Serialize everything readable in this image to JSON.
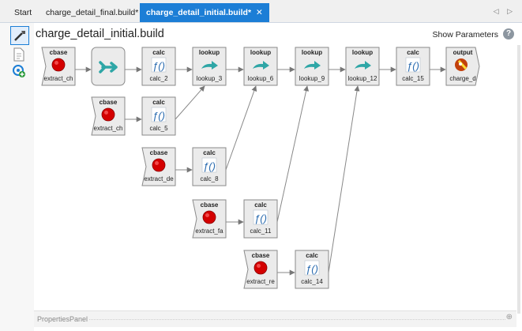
{
  "tabs": [
    {
      "label": "Start",
      "active": false
    },
    {
      "label": "charge_detail_final.build*",
      "active": false
    },
    {
      "label": "charge_detail_initial.build*",
      "active": true,
      "close": "✕"
    }
  ],
  "tab_nav": "◁ ▷",
  "sidebar": {
    "icons": [
      "wrench-icon",
      "document-icon",
      "network-add-icon"
    ]
  },
  "header": {
    "title": "charge_detail_initial.build",
    "show_parameters": "Show Parameters",
    "help": "?"
  },
  "graph": {
    "nodes": [
      {
        "id": "n0",
        "type": "cbase",
        "header": "cbase",
        "label": "extract_ch",
        "shape": "left"
      },
      {
        "id": "n1",
        "type": "join",
        "header": "",
        "label": ""
      },
      {
        "id": "n2",
        "type": "calc",
        "header": "calc",
        "label": "calc_2"
      },
      {
        "id": "n3",
        "type": "lookup",
        "header": "lookup",
        "label": "lookup_3"
      },
      {
        "id": "n4",
        "type": "lookup",
        "header": "lookup",
        "label": "lookup_6"
      },
      {
        "id": "n5",
        "type": "lookup",
        "header": "lookup",
        "label": "lookup_9"
      },
      {
        "id": "n6",
        "type": "lookup",
        "header": "lookup",
        "label": "lookup_12"
      },
      {
        "id": "n7",
        "type": "calc",
        "header": "calc",
        "label": "calc_15"
      },
      {
        "id": "n8",
        "type": "output",
        "header": "output",
        "label": "charge_d"
      },
      {
        "id": "n9",
        "type": "cbase",
        "header": "cbase",
        "label": "extract_ch"
      },
      {
        "id": "n10",
        "type": "calc",
        "header": "calc",
        "label": "calc_5"
      },
      {
        "id": "n11",
        "type": "cbase",
        "header": "cbase",
        "label": "extract_de"
      },
      {
        "id": "n12",
        "type": "calc",
        "header": "calc",
        "label": "calc_8"
      },
      {
        "id": "n13",
        "type": "cbase",
        "header": "cbase",
        "label": "extract_fa"
      },
      {
        "id": "n14",
        "type": "calc",
        "header": "calc",
        "label": "calc_11"
      },
      {
        "id": "n15",
        "type": "cbase",
        "header": "cbase",
        "label": "extract_re"
      },
      {
        "id": "n16",
        "type": "calc",
        "header": "calc",
        "label": "calc_14"
      }
    ],
    "edges": [
      [
        "n0",
        "n1"
      ],
      [
        "n1",
        "n2"
      ],
      [
        "n2",
        "n3"
      ],
      [
        "n3",
        "n4"
      ],
      [
        "n4",
        "n5"
      ],
      [
        "n5",
        "n6"
      ],
      [
        "n6",
        "n7"
      ],
      [
        "n7",
        "n8"
      ],
      [
        "n9",
        "n10"
      ],
      [
        "n10",
        "n3"
      ],
      [
        "n11",
        "n12"
      ],
      [
        "n12",
        "n4"
      ],
      [
        "n13",
        "n14"
      ],
      [
        "n14",
        "n5"
      ],
      [
        "n15",
        "n16"
      ],
      [
        "n16",
        "n6"
      ]
    ],
    "fx_glyph": "ƒ()",
    "colors": {
      "accent": "#1c7ed6",
      "red": "#d40000",
      "teal": "#2ea6a6",
      "node_fill": "#ebebeb",
      "node_stroke": "#8a8a8a"
    }
  },
  "properties_panel": {
    "label": "PropertiesPanel",
    "pin": "⊕"
  }
}
